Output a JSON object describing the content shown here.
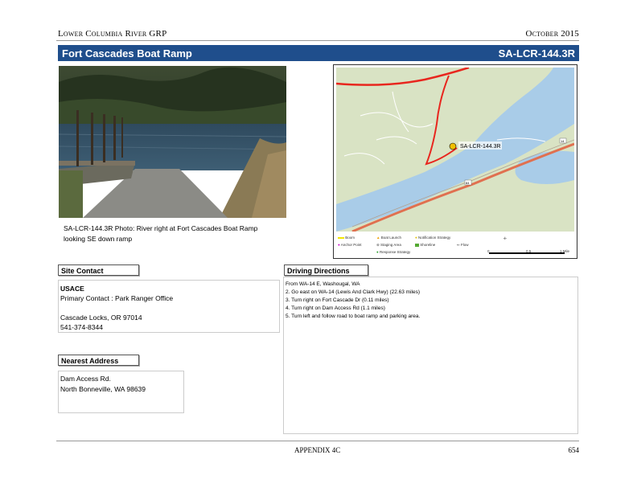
{
  "header": {
    "left": "Lower Columbia River GRP",
    "right": "October 2015"
  },
  "title": {
    "name": "Fort Cascades Boat Ramp",
    "code": "SA-LCR-144.3R"
  },
  "photo": {
    "caption": "SA-LCR-144.3R Photo: River right at Fort Cascades Boat Ramp looking SE down ramp"
  },
  "map": {
    "site_label": "SA-LCR-144.3R",
    "route_label": "14",
    "highway_label": "84",
    "legend": [
      {
        "label": "Boom",
        "color": "#f2e600"
      },
      {
        "label": "Boat Launch",
        "color": "#f0a000"
      },
      {
        "label": "Notification Strategy",
        "color": "#e0c000"
      },
      {
        "label": "Staging Area",
        "color": "#555555"
      },
      {
        "label": "Anchor Point",
        "color": "#cc00cc"
      },
      {
        "label": "Response Strategy",
        "color": "#2a9d2a"
      },
      {
        "label": "Shoreline",
        "color": "#55aa33"
      },
      {
        "label": "Flow",
        "color": "#555555"
      }
    ],
    "scale_labels": [
      "0",
      "0.5",
      "1 Mile"
    ]
  },
  "site_contact": {
    "label": "Site Contact",
    "org": "USACE",
    "primary": "Primary Contact : Park Ranger Office",
    "city": "Cascade Locks, OR 97014",
    "phone": "541-374-8344"
  },
  "nearest_address": {
    "label": "Nearest Address",
    "line1": "Dam Access Rd.",
    "line2": "North Bonneville, WA 98639"
  },
  "driving_directions": {
    "label": "Driving Directions",
    "lines": [
      "From WA-14 E, Washougal, WA",
      "2. Go east on WA-14 (Lewis And Clark Hwy) (22.63 miles)",
      "3. Turn right on Fort Cascade Dr (0.11 miles)",
      "4. Turn right on Dam Access Rd (1.1 miles)",
      "5. Turn left and follow road to boat ramp and parking area."
    ]
  },
  "footer": {
    "center": "APPENDIX 4C",
    "page": "654"
  }
}
